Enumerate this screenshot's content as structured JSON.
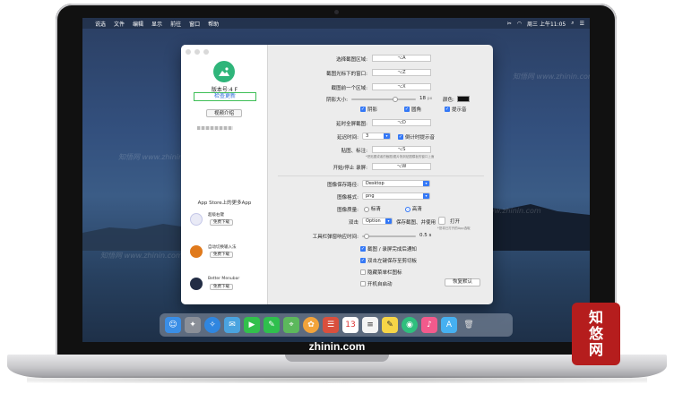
{
  "menubar": {
    "items": [
      "说选",
      "文件",
      "编辑",
      "显示",
      "前往",
      "窗口",
      "帮助"
    ],
    "clock": "周三 上午11:05"
  },
  "sidebar": {
    "version": "版本号:4  F",
    "check_update": "检查更新",
    "video_intro": "视频介绍",
    "more_apps_title": "App Store上的更多App",
    "apps": [
      {
        "name": "超级右键",
        "download": "免费下载",
        "color": "#e9eaf6"
      },
      {
        "name": "自动切换输入法",
        "download": "免费下载",
        "color": "#e07a1c"
      },
      {
        "name": "Better Menubar",
        "download": "免费下载",
        "color": "#222c44"
      }
    ]
  },
  "settings": {
    "select_region_label": "选择截图区域:",
    "select_region_key": "⌥A",
    "window_under_cursor_label": "截图光标下的窗口:",
    "window_under_cursor_key": "⌥Z",
    "previous_region_label": "截图前一个区域:",
    "previous_region_key": "⌥X",
    "shadow_size_label": "阴影大小:",
    "shadow_size_value": "18",
    "shadow_size_unit": "px",
    "color_label": "颜色:",
    "shadow_cb": "阴影",
    "round_corner_cb": "圆角",
    "sound_cb": "提示音",
    "delayed_fullscreen_label": "延时全屏截图:",
    "delayed_fullscreen_key": "⌥D",
    "delay_time_label": "延迟时间:",
    "delay_time_value": "3",
    "countdown_sound_cb": "倒计时提示音",
    "paste_label": "贴图、标注:",
    "paste_key": "⌥S",
    "paste_hint": "*把贴图或者的截图/图片拖到贴图模板的窗口上面",
    "record_label": "开始/停止 录屏:",
    "record_key": "⌥W",
    "save_path_label": "图像保存路径:",
    "save_path_value": "Desktop",
    "format_label": "图像格式:",
    "format_value": "png",
    "quality_label": "图像质量:",
    "quality_standard": "标清",
    "quality_high": "高清",
    "double_click_label": "双击",
    "double_click_value": "Option",
    "double_click_action": "保存截图、并使用",
    "open_with_label": "打开",
    "open_with_hint": "*您将已打开的App选取",
    "toolbar_delay_label": "工具栏弹窗响应时间:",
    "toolbar_delay_value": "0.5",
    "toolbar_delay_unit": "s",
    "notify_cb": "截图 / 录屏完成后通知",
    "double_left_cb": "双击左键保存至剪切板",
    "hide_menubar_cb": "隐藏菜单栏图标",
    "launch_login_cb": "开机自启动",
    "reset_button": "恢复默认"
  },
  "watermark": "知悟网 www.zhinin.com",
  "site_text": "zhinin.com",
  "seal_text": [
    "知",
    "悠",
    "网"
  ]
}
